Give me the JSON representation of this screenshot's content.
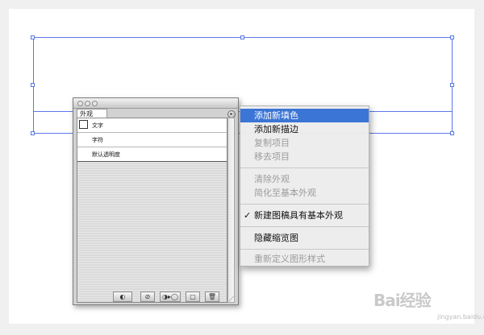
{
  "palette": {
    "tab_label": "外观",
    "items": [
      {
        "label": "文字"
      },
      {
        "label": "字符"
      },
      {
        "label": "默认透明度"
      }
    ],
    "footer_buttons": [
      "◐",
      "⊘",
      "◑▸◯",
      "▢",
      "🗑"
    ]
  },
  "context_menu": {
    "items": [
      {
        "label": "添加新填色",
        "state": "highlighted"
      },
      {
        "label": "添加新描边",
        "state": "enabled"
      },
      {
        "label": "复制项目",
        "state": "disabled"
      },
      {
        "label": "移去项目",
        "state": "disabled"
      },
      {
        "label": "清除外观",
        "state": "disabled"
      },
      {
        "label": "简化至基本外观",
        "state": "disabled"
      },
      {
        "label": "新建图稿具有基本外观",
        "state": "checked",
        "check_glyph": "✓"
      },
      {
        "label": "隐藏缩览图",
        "state": "enabled"
      },
      {
        "label": "重新定义图形样式",
        "state": "disabled"
      }
    ]
  },
  "watermark": {
    "text": "Bai经验",
    "sub": "jingyan.baidu.com"
  },
  "colors": {
    "accent": "#3b75d5",
    "selection": "#5a78e6"
  }
}
